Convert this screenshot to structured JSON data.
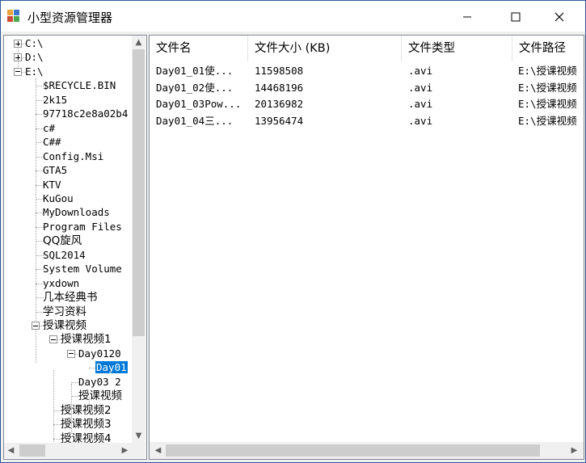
{
  "window": {
    "title": "小型资源管理器"
  },
  "tree": {
    "nodes": [
      {
        "label": "C:\\",
        "expander": "plus"
      },
      {
        "label": "D:\\",
        "expander": "plus"
      },
      {
        "label": "E:\\",
        "expander": "minus"
      },
      {
        "label": "$RECYCLE.BIN"
      },
      {
        "label": "2k15"
      },
      {
        "label": "97718c2e8a02b4"
      },
      {
        "label": "c#"
      },
      {
        "label": "C##"
      },
      {
        "label": "Config.Msi"
      },
      {
        "label": "GTA5"
      },
      {
        "label": "KTV"
      },
      {
        "label": "KuGou"
      },
      {
        "label": "MyDownloads"
      },
      {
        "label": "Program Files"
      },
      {
        "label": "QQ旋风"
      },
      {
        "label": "SQL2014"
      },
      {
        "label": "System Volume"
      },
      {
        "label": "yxdown"
      },
      {
        "label": "几本经典书"
      },
      {
        "label": "学习资料"
      },
      {
        "label": "授课视频",
        "expander": "minus"
      },
      {
        "label": "授课视频1",
        "expander": "minus"
      },
      {
        "label": "Day0120",
        "expander": "minus"
      },
      {
        "label": "Day01",
        "selected": true
      },
      {
        "label": "Day03 2"
      },
      {
        "label": "授课视频"
      },
      {
        "label": "授课视频2"
      },
      {
        "label": "授课视频3"
      },
      {
        "label": "授课视频4"
      }
    ]
  },
  "list": {
    "columns": [
      "文件名",
      "文件大小 (KB)",
      "文件类型",
      "文件路径"
    ],
    "rows": [
      [
        "Day01_01使...",
        "11598508",
        ".avi",
        "E:\\授课视频"
      ],
      [
        "Day01_02使...",
        "14468196",
        ".avi",
        "E:\\授课视频"
      ],
      [
        "Day01_03Pow...",
        "20136982",
        ".avi",
        "E:\\授课视频"
      ],
      [
        "Day01_04三...",
        "13956474",
        ".avi",
        "E:\\授课视频"
      ]
    ]
  },
  "icons": {
    "minimize": "minimize-icon",
    "maximize": "maximize-icon",
    "close": "close-icon",
    "scroll_up": "arrow-up-icon",
    "scroll_down": "arrow-down-icon",
    "scroll_left": "arrow-left-icon",
    "scroll_right": "arrow-right-icon"
  },
  "colors": {
    "selection": "#0078d7",
    "border": "#828790",
    "window_border": "#2b579a"
  }
}
